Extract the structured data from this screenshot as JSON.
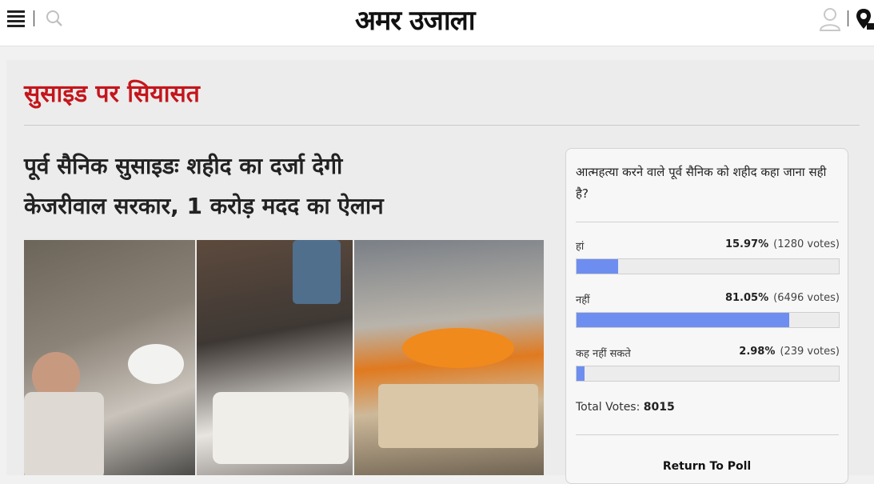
{
  "header": {
    "logo": "अमर उजाला",
    "icons": [
      "menu-icon",
      "search-icon",
      "user-icon",
      "location-icon"
    ]
  },
  "section": {
    "title": "सुसाइड पर सियासत"
  },
  "article": {
    "headline_line1": "पूर्व सैनिक सुसाइडः शहीद का दर्जा देगी",
    "headline_line2": "केजरीवाल सरकार, 1 करोड़ मदद का ऐलान"
  },
  "poll": {
    "question": "आत्महत्या करने वाले पूर्व सैनिक को शहीद कहा जाना सही है?",
    "options": [
      {
        "label": "हां",
        "percent": "15.97%",
        "votes": "(1280 votes)",
        "fraction": 0.1597
      },
      {
        "label": "नहीं",
        "percent": "81.05%",
        "votes": "(6496 votes)",
        "fraction": 0.8105
      },
      {
        "label": "कह नहीं सकते",
        "percent": "2.98%",
        "votes": "(239 votes)",
        "fraction": 0.0298
      }
    ],
    "total_label": "Total Votes:",
    "total_value": "8015",
    "return_label": "Return To Poll",
    "bar_color": "#6d8ef0"
  },
  "colors": {
    "section_title": "#c4161c",
    "background": "#ececec"
  }
}
